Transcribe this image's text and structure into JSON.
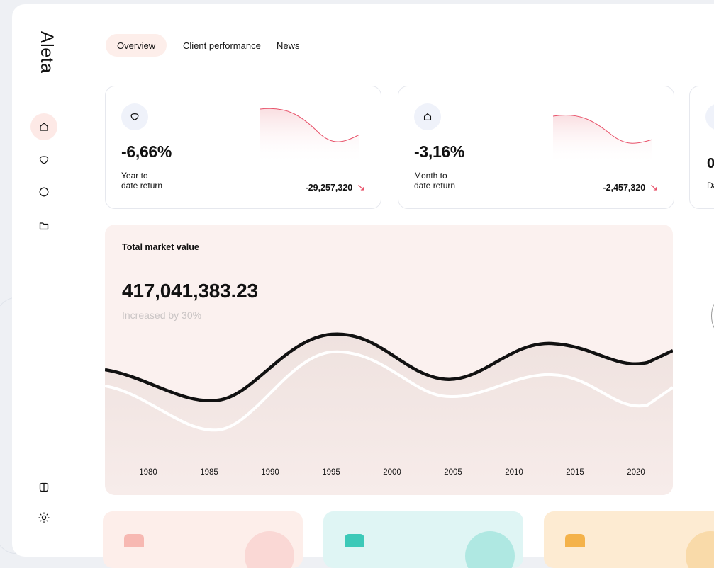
{
  "app": {
    "logo": "Aleta"
  },
  "tabs": [
    {
      "label": "Overview",
      "active": true
    },
    {
      "label": "Client performance"
    },
    {
      "label": "News"
    }
  ],
  "sidebar": {
    "icons": [
      "home-icon",
      "shield-icon",
      "circle-icon",
      "folder-icon"
    ],
    "bottom_icons": [
      "panel-toggle-icon",
      "sun-icon"
    ]
  },
  "cards": [
    {
      "value": "-6,66%",
      "label_line1": "Year to",
      "label_line2": "date return",
      "delta": "-29,257,320",
      "icon": "shield-icon"
    },
    {
      "value": "-3,16%",
      "label_line1": "Month to",
      "label_line2": "date return",
      "delta": "-2,457,320",
      "icon": "home-icon"
    },
    {
      "value": "0",
      "label_line1": "Da"
    }
  ],
  "market": {
    "title": "Total market value",
    "value": "417,041,383.23",
    "subtitle": "Increased by 30%"
  },
  "chart_data": {
    "type": "line",
    "x": [
      "1980",
      "1985",
      "1990",
      "1995",
      "2000",
      "2005",
      "2010",
      "2015",
      "2020"
    ],
    "title": "Total market value"
  },
  "colors": {
    "accent": "#e8526a",
    "market_bg": "#fbf1ef",
    "tab_active": "#fdeeea",
    "tile1": "#fdeeea",
    "tile2": "#dff5f4",
    "tile3": "#fdebd2"
  }
}
